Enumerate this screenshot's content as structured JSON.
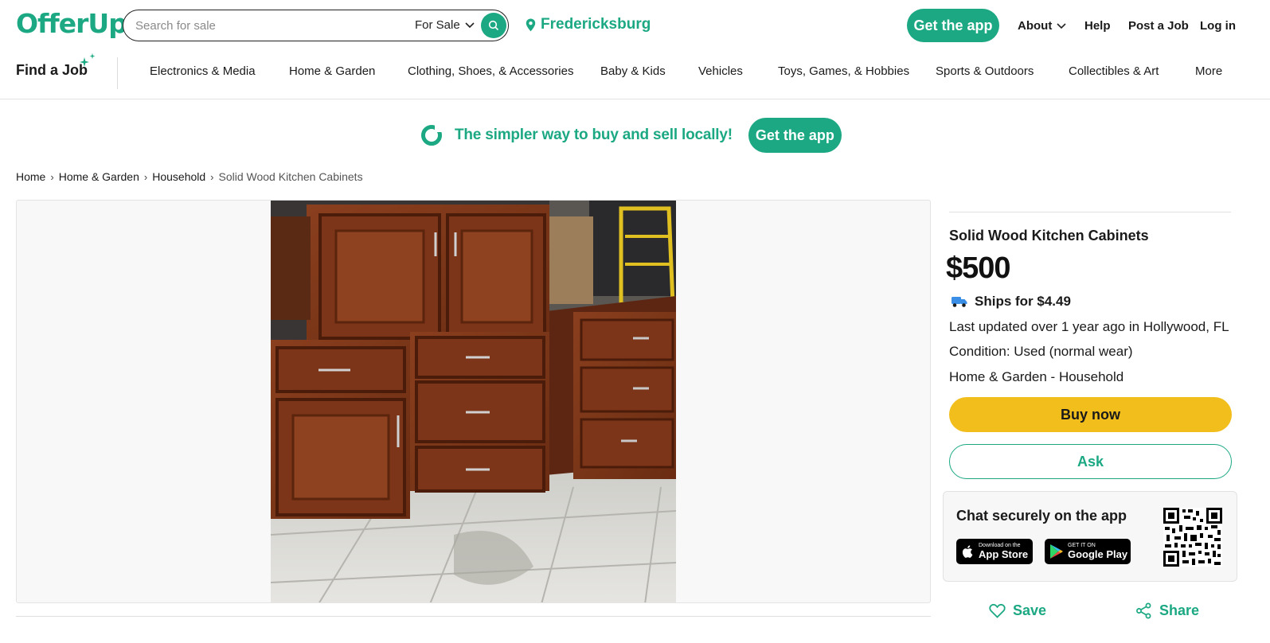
{
  "header": {
    "logo": "OfferUp",
    "search_placeholder": "Search for sale",
    "search_scope": "For Sale",
    "location": "Fredericksburg",
    "get_app": "Get the app",
    "nav": {
      "about": "About",
      "help": "Help",
      "post_job": "Post a Job",
      "login": "Log in"
    }
  },
  "categories": {
    "find_job": "Find a Job",
    "items": [
      "Electronics & Media",
      "Home & Garden",
      "Clothing, Shoes, & Accessories",
      "Baby & Kids",
      "Vehicles",
      "Toys, Games, & Hobbies",
      "Sports & Outdoors",
      "Collectibles & Art",
      "More"
    ]
  },
  "promo": {
    "text": "The simpler way to buy and sell locally!",
    "button": "Get the app"
  },
  "breadcrumb": {
    "items": [
      "Home",
      "Home & Garden",
      "Household"
    ],
    "current": "Solid Wood Kitchen Cabinets"
  },
  "listing": {
    "title": "Solid Wood Kitchen Cabinets",
    "price": "$500",
    "shipping": "Ships for $4.49",
    "updated": "Last updated over 1 year ago in Hollywood, FL",
    "condition": "Condition: Used (normal wear)",
    "category": "Home & Garden - Household",
    "buy_now": "Buy now",
    "ask": "Ask",
    "save": "Save",
    "share": "Share"
  },
  "chat": {
    "title": "Chat securely on the app",
    "app_store_small": "Download on the",
    "app_store": "App Store",
    "google_play_small": "GET IT ON",
    "google_play": "Google Play"
  },
  "colors": {
    "brand": "#1ba883",
    "buy_now": "#f2be1c"
  }
}
